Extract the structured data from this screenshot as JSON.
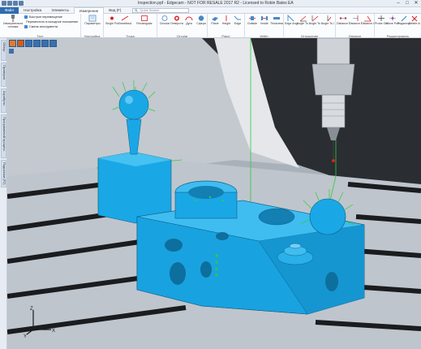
{
  "title": "Inspection.ppf - Edgecam - NOT FOR RESALE 2017 R2 - Licensed to Robin Bates EA",
  "window": {
    "minimize": "–",
    "maximize": "□",
    "close": "✕"
  },
  "tabs": [
    {
      "label": "Файл",
      "kind": "file"
    },
    {
      "label": "Настройка",
      "kind": "normal"
    },
    {
      "label": "Элементы",
      "kind": "normal"
    },
    {
      "label": "Измерение",
      "kind": "active"
    },
    {
      "label": "Вид (F)",
      "kind": "normal"
    }
  ],
  "search": {
    "placeholder": "Quick Search"
  },
  "ribbon": {
    "first_button": "Измерительная головка",
    "small_items": [
      "Быстрое перемещение",
      "Переместить в исходное положение",
      "Смена инструмента"
    ],
    "groups": [
      {
        "label": "Тест"
      },
      {
        "label": "Настройка"
      },
      {
        "label": "Точка"
      },
      {
        "label": "Circular"
      },
      {
        "label": "Plane"
      },
      {
        "label": "Width"
      },
      {
        "label": "Отношение"
      },
      {
        "label": "Distance"
      },
      {
        "label": "Редактировать"
      }
    ],
    "buttons": [
      "Параметры",
      "Single Point",
      "Линейный",
      "Rectangular",
      "Circular",
      "Отверстие",
      "Дуга",
      "Сфера",
      "Plane",
      "Height",
      "Edge",
      "Outside",
      "Inside",
      "Thickness",
      "Edge Angle",
      "Angle To X Axis",
      "Angle To Y Axis",
      "Angle To Z Axis",
      "Distance To Point",
      "Distance To Line",
      "Distance Angle",
      "Probe Orientation",
      "Move Point",
      "Редактировать",
      "Delete All"
    ]
  },
  "side_tabs": [
    "Обзор",
    "Проверка",
    "Атрибуты",
    "Программный процесс",
    "Подсказки (F2)"
  ],
  "axes": {
    "x": "X",
    "y": "Y",
    "z": "Z"
  },
  "colors": {
    "part": "#1aa7e6",
    "ribbon_accent": "#2f6bb0",
    "probe_lines": "#2ecc40"
  }
}
